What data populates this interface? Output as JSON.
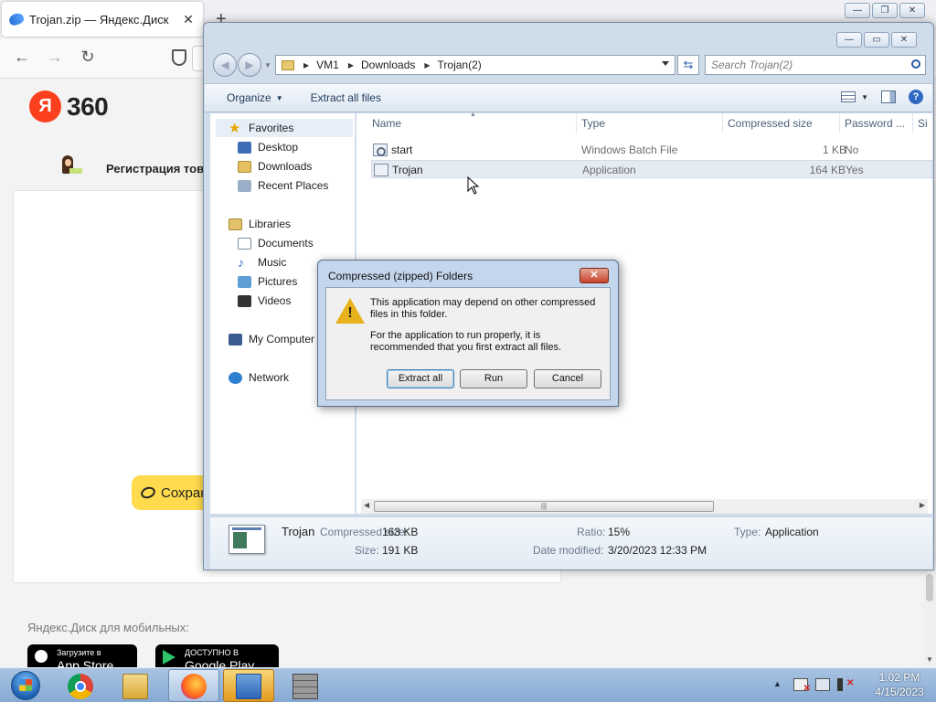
{
  "browser": {
    "tab_title": "Trojan.zip — Яндекс.Диск",
    "tab_close": "✕",
    "new_tab": "+",
    "nav": {
      "back": "←",
      "forward": "→",
      "reload": "↻"
    }
  },
  "yandex": {
    "logo_letter": "Я",
    "logo_text": "360",
    "registration_text": "Регистрация тов",
    "save_label": "Сохран",
    "mobile_label": "Яндекс.Диск для мобильных:",
    "app_store": {
      "small": "Загрузите в",
      "big": "App Store"
    },
    "google_play": {
      "small": "ДОСТУПНО В",
      "big": "Google Play"
    }
  },
  "browser_window_buttons": {
    "minimize": "—",
    "restore": "❐",
    "close": "✕"
  },
  "explorer": {
    "window_buttons": {
      "minimize": "—",
      "maximize": "▭",
      "close": "✕"
    },
    "breadcrumb": [
      "VM1",
      "Downloads",
      "Trojan(2)"
    ],
    "search_placeholder": "Search Trojan(2)",
    "toolbar": {
      "organize": "Organize",
      "extract_all": "Extract all files",
      "help": "?"
    },
    "nav_pane": {
      "favorites": "Favorites",
      "favorites_items": [
        "Desktop",
        "Downloads",
        "Recent Places"
      ],
      "libraries": "Libraries",
      "libraries_items": [
        "Documents",
        "Music",
        "Pictures",
        "Videos"
      ],
      "my_computer": "My Computer",
      "network": "Network"
    },
    "columns": [
      "Name",
      "Type",
      "Compressed size",
      "Password ...",
      "Si"
    ],
    "files": [
      {
        "name": "start",
        "type": "Windows Batch File",
        "size": "1 KB",
        "password": "No"
      },
      {
        "name": "Trojan",
        "type": "Application",
        "size": "164 KB",
        "password": "Yes"
      }
    ],
    "scroll_grip": "|||",
    "details": {
      "name": "Trojan",
      "compressed_label": "Compressed size:",
      "compressed_value": "163 KB",
      "size_label": "Size:",
      "size_value": "191 KB",
      "ratio_label": "Ratio:",
      "ratio_value": "15%",
      "modified_label": "Date modified:",
      "modified_value": "3/20/2023 12:33 PM",
      "type_label": "Type:",
      "type_value": "Application"
    }
  },
  "dialog": {
    "title": "Compressed (zipped) Folders",
    "close": "✕",
    "message_1": "This application may depend on other compressed files in this folder.",
    "message_2": "For the application to run properly, it is recommended that you first extract all files.",
    "buttons": {
      "extract_all": "Extract all",
      "run": "Run",
      "cancel": "Cancel"
    }
  },
  "taskbar": {
    "time": "1:02 PM",
    "date": "4/15/2023"
  }
}
